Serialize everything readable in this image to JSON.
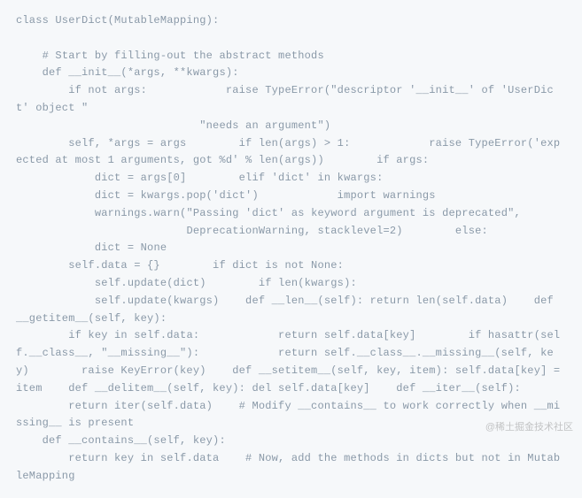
{
  "code": "class UserDict(MutableMapping):\n\n    # Start by filling-out the abstract methods\n    def __init__(*args, **kwargs):\n        if not args:            raise TypeError(\"descriptor '__init__' of 'UserDict' object \"\n                            \"needs an argument\")\n        self, *args = args        if len(args) > 1:            raise TypeError('expected at most 1 arguments, got %d' % len(args))        if args:\n            dict = args[0]        elif 'dict' in kwargs:\n            dict = kwargs.pop('dict')            import warnings\n            warnings.warn(\"Passing 'dict' as keyword argument is deprecated\",\n                          DeprecationWarning, stacklevel=2)        else:\n            dict = None\n        self.data = {}        if dict is not None:\n            self.update(dict)        if len(kwargs):\n            self.update(kwargs)    def __len__(self): return len(self.data)    def __getitem__(self, key):\n        if key in self.data:            return self.data[key]        if hasattr(self.__class__, \"__missing__\"):            return self.__class__.__missing__(self, key)        raise KeyError(key)    def __setitem__(self, key, item): self.data[key] = item    def __delitem__(self, key): del self.data[key]    def __iter__(self):\n        return iter(self.data)    # Modify __contains__ to work correctly when __missing__ is present\n    def __contains__(self, key):\n        return key in self.data    # Now, add the methods in dicts but not in MutableMapping",
  "watermark": "@稀土掘金技术社区"
}
